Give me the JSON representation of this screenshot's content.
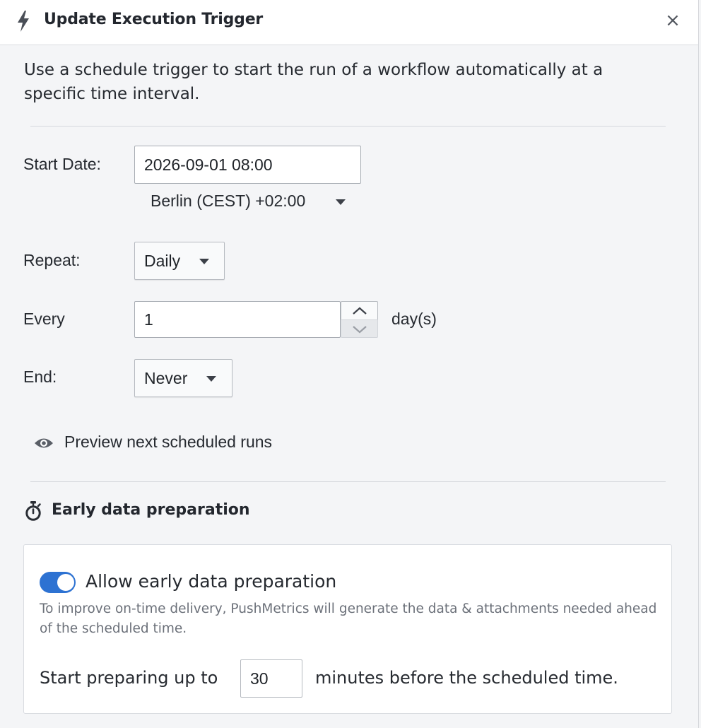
{
  "dialog": {
    "title": "Update Execution Trigger",
    "close_label": "×",
    "description": "Use a schedule trigger to start the run of a workflow automatically at a specific time interval."
  },
  "schedule": {
    "start_date_label": "Start Date:",
    "start_date_value": "2026-09-01 08:00",
    "timezone": "Berlin (CEST) +02:00",
    "repeat_label": "Repeat:",
    "repeat_value": "Daily",
    "every_label": "Every",
    "every_value": "1",
    "every_unit": "day(s)",
    "end_label": "End:",
    "end_value": "Never",
    "preview_label": "Preview next scheduled runs"
  },
  "early_prep": {
    "section_title": "Early data preparation",
    "toggle_label": "Allow early data preparation",
    "toggle_on": true,
    "helper_text": "To improve on-time delivery, PushMetrics will generate the data & attachments needed ahead of the scheduled time.",
    "prep_prefix": "Start preparing up to",
    "prep_minutes": "30",
    "prep_suffix": "minutes before the scheduled time."
  },
  "colors": {
    "accent": "#2d72d2",
    "background": "#f4f5f7",
    "helper_text": "#6b7079"
  },
  "icons": [
    "bolt-icon",
    "close-icon",
    "caret-down-icon",
    "chevron-up-icon",
    "chevron-down-icon",
    "eye-icon",
    "stopwatch-icon"
  ]
}
